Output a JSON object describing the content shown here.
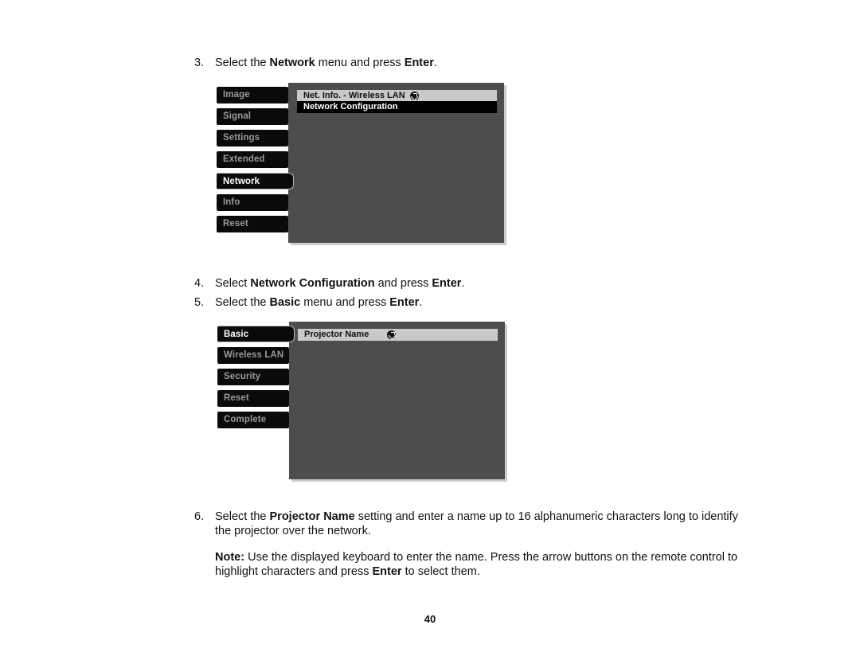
{
  "document": {
    "page_number": "40"
  },
  "steps": [
    {
      "number": "3.",
      "parts": [
        {
          "text": "Select the ",
          "bold": false
        },
        {
          "text": "Network",
          "bold": true
        },
        {
          "text": " menu and press ",
          "bold": false
        },
        {
          "text": "Enter",
          "bold": true
        },
        {
          "text": ".",
          "bold": false
        }
      ]
    },
    {
      "number": "4.",
      "parts": [
        {
          "text": "Select ",
          "bold": false
        },
        {
          "text": "Network Configuration",
          "bold": true
        },
        {
          "text": " and press ",
          "bold": false
        },
        {
          "text": "Enter",
          "bold": true
        },
        {
          "text": ".",
          "bold": false
        }
      ]
    },
    {
      "number": "5.",
      "parts": [
        {
          "text": "Select the ",
          "bold": false
        },
        {
          "text": "Basic",
          "bold": true
        },
        {
          "text": " menu and press ",
          "bold": false
        },
        {
          "text": "Enter",
          "bold": true
        },
        {
          "text": ".",
          "bold": false
        }
      ]
    },
    {
      "number": "6.",
      "parts": [
        {
          "text": "Select the ",
          "bold": false
        },
        {
          "text": "Projector Name",
          "bold": true
        },
        {
          "text": " setting and enter a name up to 16 alphanumeric characters long to identify the projector over the network.",
          "bold": false
        }
      ]
    }
  ],
  "note": {
    "parts": [
      {
        "text": "Note:",
        "bold": true
      },
      {
        "text": " Use the displayed keyboard to enter the name. Press the arrow buttons on the remote control to highlight characters and press ",
        "bold": false
      },
      {
        "text": "Enter",
        "bold": true
      },
      {
        "text": " to select them.",
        "bold": false
      }
    ]
  },
  "osd_menus": [
    {
      "name": "network-menu",
      "sidebar_items": [
        {
          "label": "Image",
          "selected": false
        },
        {
          "label": "Signal",
          "selected": false
        },
        {
          "label": "Settings",
          "selected": false
        },
        {
          "label": "Extended",
          "selected": false
        },
        {
          "label": "Network",
          "selected": true
        },
        {
          "label": "Info",
          "selected": false
        },
        {
          "label": "Reset",
          "selected": false
        }
      ],
      "rows": [
        {
          "label": "Net. Info. - Wireless LAN",
          "highlighted": true,
          "enter_icon": true
        },
        {
          "label": "Network Configuration",
          "highlighted": false,
          "enter_icon": false
        }
      ]
    },
    {
      "name": "network-configuration-basic-menu",
      "sidebar_items": [
        {
          "label": "Basic",
          "selected": true
        },
        {
          "label": "Wireless LAN",
          "selected": false
        },
        {
          "label": "Security",
          "selected": false
        },
        {
          "label": "Reset",
          "selected": false
        },
        {
          "label": "Complete",
          "selected": false
        }
      ],
      "rows": [
        {
          "label": "Projector Name",
          "highlighted": true,
          "enter_icon": true
        }
      ]
    }
  ],
  "colors": {
    "panel_bg": "#4d4d4d",
    "item_bg": "#0a0a0a",
    "item_text": "#9a9a9a",
    "item_selected_text": "#ffffff",
    "row_highlight_bg": "#c9c9c9",
    "row_plain_bg": "#000000"
  }
}
